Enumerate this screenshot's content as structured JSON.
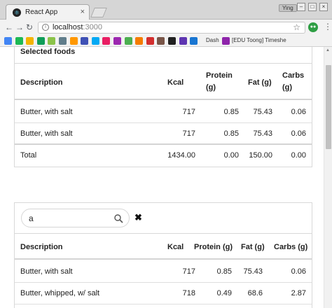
{
  "browser": {
    "tab_title": "React App",
    "tab_close": "×",
    "user_badge": "Ying",
    "url_host": "localhost",
    "url_port": ":3000",
    "bookmarks": [
      {
        "label": "",
        "color": "#4285f4"
      },
      {
        "label": "",
        "color": "#1db954"
      },
      {
        "label": "",
        "color": "#f4b400"
      },
      {
        "label": "",
        "color": "#0f9d58"
      },
      {
        "label": "",
        "color": "#8bc34a"
      },
      {
        "label": "",
        "color": "#607d8b"
      },
      {
        "label": "",
        "color": "#ff9800"
      },
      {
        "label": "",
        "color": "#3f51b5"
      },
      {
        "label": "",
        "color": "#03a9f4"
      },
      {
        "label": "",
        "color": "#e91e63"
      },
      {
        "label": "",
        "color": "#9c27b0"
      },
      {
        "label": "",
        "color": "#4caf50"
      },
      {
        "label": "",
        "color": "#f57c00"
      },
      {
        "label": "",
        "color": "#d32f2f"
      },
      {
        "label": "",
        "color": "#795548"
      },
      {
        "label": "",
        "color": "#212121"
      },
      {
        "label": "",
        "color": "#5e35b1"
      },
      {
        "label": "",
        "color": "#1976d2"
      }
    ],
    "bookmark_dash": "Dash",
    "bookmark_edu": "[EDU Toong] Timeshe"
  },
  "selected": {
    "title": "Selected foods",
    "headers": {
      "description": "Description",
      "kcal": "Kcal",
      "protein_line1": "Protein",
      "protein_line2": "(g)",
      "fat": "Fat (g)",
      "carbs_line1": "Carbs",
      "carbs_line2": "(g)"
    },
    "rows": [
      {
        "description": "Butter, with salt",
        "kcal": "717",
        "protein": "0.85",
        "fat": "75.43",
        "carbs": "0.06"
      },
      {
        "description": "Butter, with salt",
        "kcal": "717",
        "protein": "0.85",
        "fat": "75.43",
        "carbs": "0.06"
      }
    ],
    "total": {
      "label": "Total",
      "kcal": "1434.00",
      "protein": "0.00",
      "fat": "150.00",
      "carbs": "0.00"
    }
  },
  "search": {
    "value": "a",
    "clear_icon": "✖",
    "headers": {
      "description": "Description",
      "kcal": "Kcal",
      "protein": "Protein (g)",
      "fat": "Fat (g)",
      "carbs": "Carbs (g)"
    },
    "rows": [
      {
        "description": "Butter, with salt",
        "kcal": "717",
        "protein": "0.85",
        "fat": "75.43",
        "carbs": "0.06"
      },
      {
        "description": "Butter, whipped, w/ salt",
        "kcal": "718",
        "protein": "0.49",
        "fat": "68.6",
        "carbs": "2.87"
      }
    ]
  }
}
